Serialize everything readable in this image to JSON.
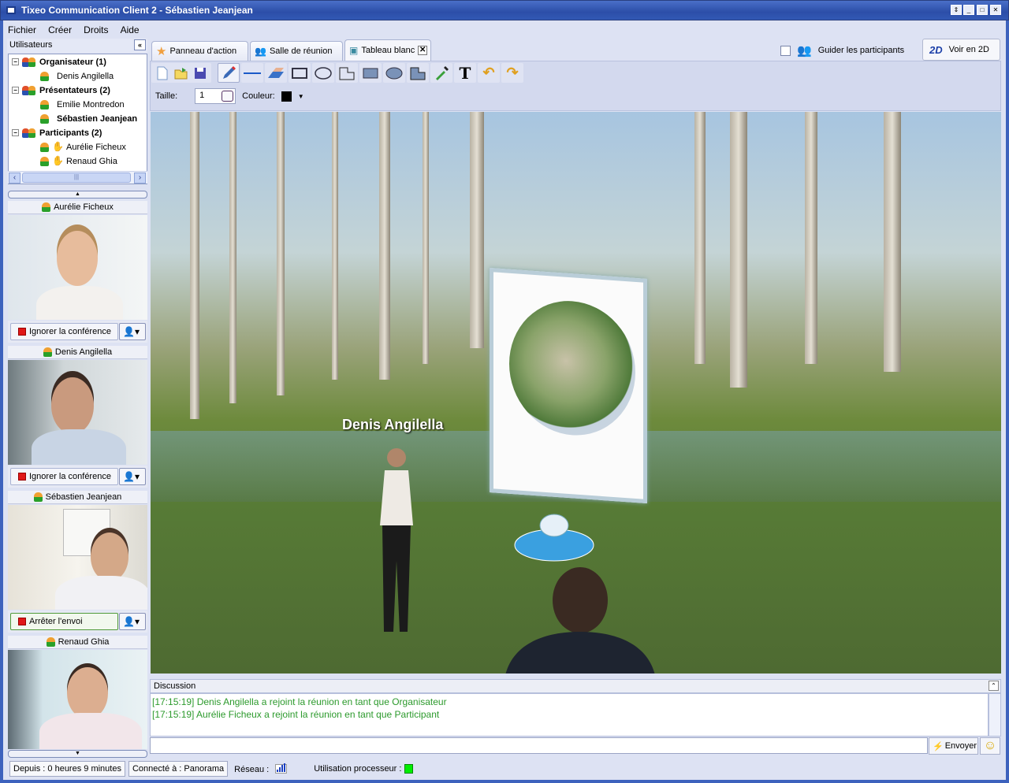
{
  "window": {
    "title": "Tixeo Communication Client 2 - Sébastien Jeanjean"
  },
  "menu": [
    {
      "label": "Fichier"
    },
    {
      "label": "Créer"
    },
    {
      "label": "Droits"
    },
    {
      "label": "Aide"
    }
  ],
  "users": {
    "header": "Utilisateurs",
    "collapse": "«",
    "groups": [
      {
        "label": "Organisateur (1)",
        "members": [
          "Denis Angilella"
        ]
      },
      {
        "label": "Présentateurs (2)",
        "members": [
          "Emilie Montredon",
          "Sébastien Jeanjean"
        ]
      },
      {
        "label": "Participants (2)",
        "members": [
          "Aurélie Ficheux",
          "Renaud Ghia"
        ]
      }
    ]
  },
  "videos": [
    {
      "name": "Aurélie Ficheux",
      "button": "Ignorer la conférence"
    },
    {
      "name": "Denis Angilella",
      "button": "Ignorer la conférence"
    },
    {
      "name": "Sébastien Jeanjean",
      "button": "Arrêter l'envoi"
    },
    {
      "name": "Renaud Ghia"
    }
  ],
  "tabs": [
    {
      "label": "Panneau d'action"
    },
    {
      "label": "Salle de réunion"
    },
    {
      "label": "Tableau blanc",
      "close": "✕"
    }
  ],
  "guide_label": "Guider les participants",
  "view2d": {
    "badge": "2D",
    "label": "Voir en 2D"
  },
  "tools": {
    "icons": [
      "new-file",
      "open-folder",
      "save",
      "pencil",
      "line",
      "eraser",
      "rectangle",
      "ellipse",
      "polygon",
      "filled-rectangle",
      "filled-ellipse",
      "filled-polygon",
      "color-picker",
      "text",
      "undo",
      "redo"
    ]
  },
  "drawing": {
    "size_label": "Taille:",
    "size_value": "1",
    "color_label": "Couleur:",
    "color": "#000000"
  },
  "scene": {
    "avatar_label": "Denis Angilella"
  },
  "discussion": {
    "header": "Discussion",
    "messages": [
      "[17:15:19] Denis Angilella a rejoint la réunion en tant que Organisateur",
      "[17:15:19] Aurélie Ficheux a rejoint la réunion en tant que Participant"
    ],
    "send": "Envoyer",
    "message_color": "#2c9a2c"
  },
  "status": {
    "since": "Depuis : 0 heures 9 minutes",
    "connected": "Connecté à : Panorama",
    "network": "Réseau :",
    "cpu": "Utilisation processeur :"
  }
}
